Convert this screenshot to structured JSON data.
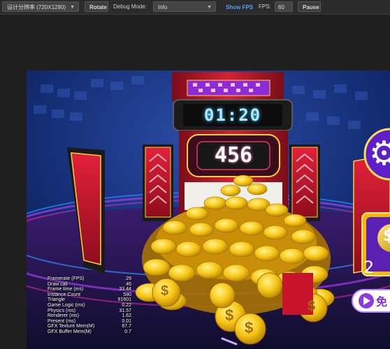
{
  "toolbar": {
    "resolution": "设计分辨率 (720X1280)",
    "rotate_label": "Rotate",
    "debug_mode_label": "Debug Mode:",
    "debug_mode_value": "Info",
    "show_fps_label": "Show FPS",
    "fps_label": "FPS:",
    "fps_value": "60",
    "pause_label": "Pause"
  },
  "game": {
    "timer": "01:20",
    "score": "456",
    "right_panel_digit": "2",
    "free_label": "免",
    "coin_symbol": "$",
    "settings_icon": "gear-icon"
  },
  "stats": [
    {
      "label": "Framerate (FPS)",
      "value": "29"
    },
    {
      "label": "Draw call",
      "value": "46"
    },
    {
      "label": "Frame time (ms)",
      "value": "33.44"
    },
    {
      "label": "Instance Count",
      "value": "580"
    },
    {
      "label": "Triangle",
      "value": "91601"
    },
    {
      "label": "Game Logic (ms)",
      "value": "0.22"
    },
    {
      "label": "Physics (ms)",
      "value": "31.57"
    },
    {
      "label": "Renderer (ms)",
      "value": "1.62"
    },
    {
      "label": "Present (ms)",
      "value": "0.01"
    },
    {
      "label": "GFX Texture Mem(M)",
      "value": "67.7"
    },
    {
      "label": "GFX Buffer Mem(M)",
      "value": "0.7"
    }
  ]
}
